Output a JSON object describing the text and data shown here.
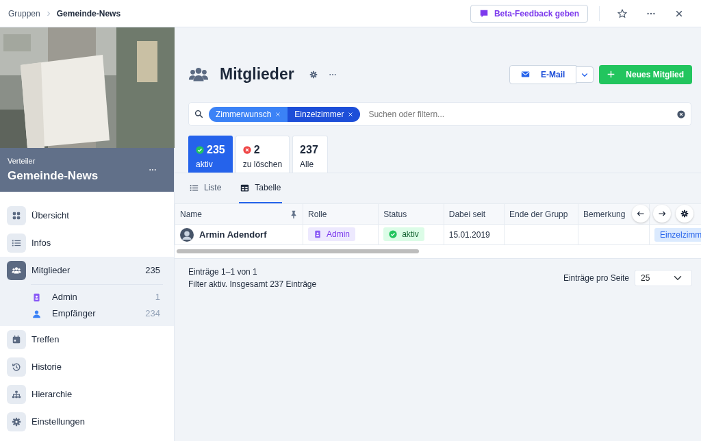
{
  "breadcrumb": [
    {
      "label": "Gruppen",
      "current": false
    },
    {
      "label": "Gemeinde-News",
      "current": true
    }
  ],
  "feedback_button": "Beta-Feedback geben",
  "sidebar": {
    "group_type": "Verteiler",
    "group_name": "Gemeinde-News",
    "nav": [
      {
        "label": "Übersicht",
        "selected": false
      },
      {
        "label": "Infos",
        "selected": false
      },
      {
        "label": "Mitglieder",
        "count": "235",
        "selected": true,
        "children": [
          {
            "label": "Admin",
            "count": "1",
            "color": "#8b5cf6"
          },
          {
            "label": "Empfänger",
            "count": "234",
            "color": "#3b82f6"
          }
        ]
      },
      {
        "label": "Treffen",
        "selected": false
      },
      {
        "label": "Historie",
        "selected": false
      },
      {
        "label": "Hierarchie",
        "selected": false
      },
      {
        "label": "Einstellungen",
        "selected": false
      }
    ]
  },
  "page_title": "Mitglieder",
  "email_button": "E-Mail",
  "new_button": "Neues Mitglied",
  "search": {
    "chips": [
      {
        "label": "Zimmerwunsch",
        "color": "#3b82f6"
      },
      {
        "label": "Einzelzimmer",
        "color": "#1d4ed8"
      }
    ],
    "placeholder": "Suchen oder filtern..."
  },
  "status_tabs": [
    {
      "kind": "ok",
      "count": "235",
      "label": "aktiv",
      "selected": true
    },
    {
      "kind": "error",
      "count": "2",
      "label": "zu löschen",
      "selected": false
    },
    {
      "kind": "none",
      "count": "237",
      "label": "Alle",
      "selected": false
    }
  ],
  "view_tabs": [
    {
      "label": "Liste",
      "selected": false
    },
    {
      "label": "Tabelle",
      "selected": true
    }
  ],
  "table": {
    "columns": [
      "Name",
      "Rolle",
      "Status",
      "Dabei seit",
      "Ende der Grupp",
      "Bemerkung"
    ],
    "rows": [
      {
        "name": "Armin Adendorf",
        "role": "Admin",
        "status": "aktiv",
        "since": "15.01.2019",
        "column_7": "Einzelzimm"
      }
    ]
  },
  "footer": {
    "range": "Einträge 1–1 von 1",
    "filter_note": "Filter aktiv. Insgesamt 237 Einträge",
    "page_size_label": "Einträge pro Seite",
    "page_size": "25"
  }
}
